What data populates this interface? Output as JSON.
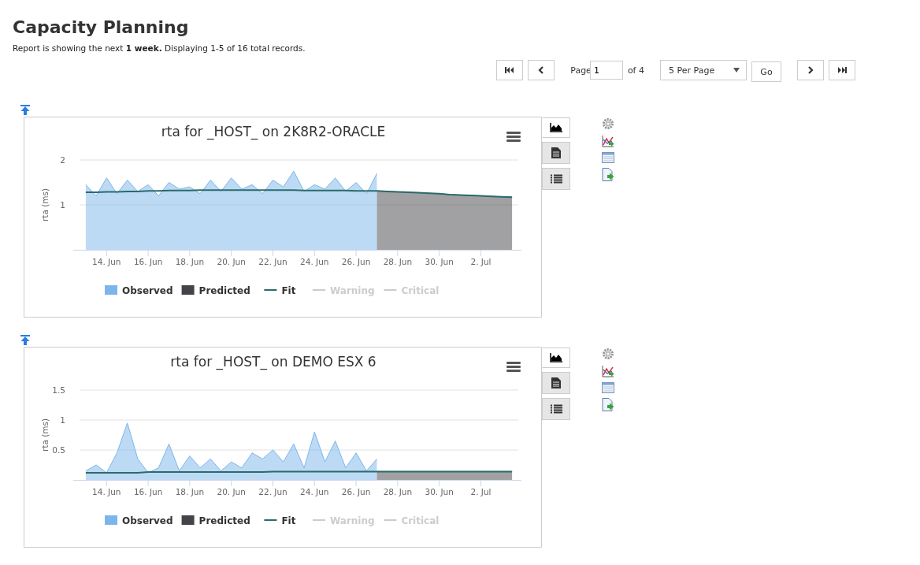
{
  "title": "Capacity Planning",
  "summary": "Report is showing the next **1 week.** Displaying 1-5 of 16 total records.",
  "pager": {
    "page_label": "Page",
    "page": "1",
    "of": "of 4",
    "per_page": "5 Per Page",
    "go": "Go"
  },
  "reports": [
    {
      "view_tabs": [
        {
          "kind": "chart",
          "selected": true
        },
        {
          "kind": "document",
          "selected": false
        },
        {
          "kind": "list",
          "selected": false
        }
      ],
      "chart_data": {
        "type": "area",
        "legend": "bottom",
        "title": "rta for _HOST_ on 2K8R2-ORACLE",
        "ylabel": "rta (ms)",
        "ylim": [
          0,
          2
        ],
        "yticks": [
          1,
          2
        ],
        "categories": [
          null,
          null,
          "14. Jun",
          null,
          null,
          null,
          "16. Jun",
          null,
          null,
          null,
          "18. Jun",
          null,
          null,
          null,
          "20. Jun",
          null,
          null,
          null,
          "22. Jun",
          null,
          null,
          null,
          "24. Jun",
          null,
          null,
          null,
          "26. Jun",
          null,
          null,
          null,
          "28. Jun",
          null,
          null,
          null,
          "30. Jun",
          null,
          null,
          null,
          "2. Jul",
          null,
          null,
          null
        ],
        "series": [
          {
            "name": "Observed",
            "type": "area",
            "color": "#7cb5ec",
            "values": [
              1.45,
              1.2,
              1.6,
              1.25,
              1.55,
              1.3,
              1.45,
              1.2,
              1.5,
              1.35,
              1.4,
              1.25,
              1.55,
              1.3,
              1.6,
              1.35,
              1.45,
              1.25,
              1.55,
              1.4,
              1.75,
              1.3,
              1.45,
              1.35,
              1.6,
              1.3,
              1.5,
              1.25,
              1.7,
              null,
              null,
              null,
              null,
              null,
              null,
              null,
              null,
              null,
              null,
              null,
              null,
              null
            ]
          },
          {
            "name": "Predicted",
            "type": "area",
            "color": "#434348",
            "values": [
              null,
              null,
              null,
              null,
              null,
              null,
              null,
              null,
              null,
              null,
              null,
              null,
              null,
              null,
              null,
              null,
              null,
              null,
              null,
              null,
              null,
              null,
              null,
              null,
              null,
              null,
              null,
              null,
              1.31,
              1.3,
              1.29,
              1.28,
              1.27,
              1.26,
              1.25,
              1.23,
              1.22,
              1.21,
              1.2,
              1.19,
              1.18,
              1.17
            ]
          },
          {
            "name": "Fit",
            "type": "line",
            "color": "#2b6b6b",
            "values": [
              1.28,
              1.28,
              1.29,
              1.29,
              1.3,
              1.3,
              1.31,
              1.31,
              1.32,
              1.32,
              1.32,
              1.33,
              1.33,
              1.33,
              1.33,
              1.33,
              1.33,
              1.33,
              1.33,
              1.33,
              1.33,
              1.32,
              1.32,
              1.32,
              1.32,
              1.32,
              1.31,
              1.31,
              1.31,
              1.3,
              1.29,
              1.28,
              1.27,
              1.26,
              1.25,
              1.23,
              1.22,
              1.21,
              1.2,
              1.19,
              1.18,
              1.17
            ]
          }
        ]
      },
      "legend_extra": [
        {
          "label": "Warning",
          "enabled": false
        },
        {
          "label": "Critical",
          "enabled": false
        }
      ]
    },
    {
      "view_tabs": [
        {
          "kind": "chart",
          "selected": true
        },
        {
          "kind": "document",
          "selected": false
        },
        {
          "kind": "list",
          "selected": false
        }
      ],
      "chart_data": {
        "type": "area",
        "legend": "bottom",
        "title": "rta for _HOST_ on DEMO ESX 6",
        "ylabel": "rta (ms)",
        "ylim": [
          0,
          1.5
        ],
        "yticks": [
          0.5,
          1,
          1.5
        ],
        "categories": [
          null,
          null,
          "14. Jun",
          null,
          null,
          null,
          "16. Jun",
          null,
          null,
          null,
          "18. Jun",
          null,
          null,
          null,
          "20. Jun",
          null,
          null,
          null,
          "22. Jun",
          null,
          null,
          null,
          "24. Jun",
          null,
          null,
          null,
          "26. Jun",
          null,
          null,
          null,
          "28. Jun",
          null,
          null,
          null,
          "30. Jun",
          null,
          null,
          null,
          "2. Jul",
          null,
          null,
          null
        ],
        "series": [
          {
            "name": "Observed",
            "type": "area",
            "color": "#7cb5ec",
            "values": [
              0.15,
              0.25,
              0.12,
              0.45,
              0.95,
              0.35,
              0.12,
              0.2,
              0.6,
              0.15,
              0.4,
              0.2,
              0.35,
              0.15,
              0.3,
              0.2,
              0.45,
              0.35,
              0.5,
              0.3,
              0.6,
              0.2,
              0.8,
              0.3,
              0.65,
              0.2,
              0.45,
              0.15,
              0.35,
              null,
              null,
              null,
              null,
              null,
              null,
              null,
              null,
              null,
              null,
              null,
              null,
              null
            ]
          },
          {
            "name": "Predicted",
            "type": "area",
            "color": "#434348",
            "values": [
              null,
              null,
              null,
              null,
              null,
              null,
              null,
              null,
              null,
              null,
              null,
              null,
              null,
              null,
              null,
              null,
              null,
              null,
              null,
              null,
              null,
              null,
              null,
              null,
              null,
              null,
              null,
              null,
              0.14,
              0.14,
              0.14,
              0.14,
              0.14,
              0.14,
              0.14,
              0.14,
              0.14,
              0.14,
              0.14,
              0.14,
              0.14,
              0.14
            ]
          },
          {
            "name": "Fit",
            "type": "line",
            "color": "#2b6b6b",
            "values": [
              0.12,
              0.12,
              0.12,
              0.12,
              0.12,
              0.12,
              0.13,
              0.13,
              0.13,
              0.13,
              0.13,
              0.13,
              0.13,
              0.13,
              0.13,
              0.13,
              0.13,
              0.13,
              0.14,
              0.14,
              0.14,
              0.14,
              0.14,
              0.14,
              0.14,
              0.14,
              0.14,
              0.14,
              0.14,
              0.14,
              0.14,
              0.14,
              0.14,
              0.14,
              0.14,
              0.14,
              0.14,
              0.14,
              0.14,
              0.14,
              0.14,
              0.14
            ]
          }
        ]
      },
      "legend_extra": [
        {
          "label": "Warning",
          "enabled": false
        },
        {
          "label": "Critical",
          "enabled": false
        }
      ]
    }
  ]
}
